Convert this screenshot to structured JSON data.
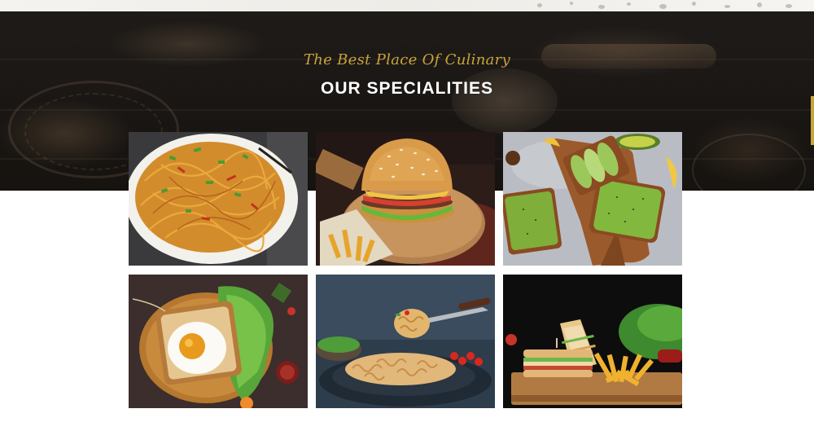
{
  "section": {
    "subtitle": "The Best Place Of Culinary",
    "title": "OUR SPECIALITIES"
  },
  "colors": {
    "accent": "#c9a33c",
    "hero_bg": "#1b1815",
    "title": "#ffffff"
  },
  "gallery": {
    "items": [
      {
        "icon": "noodles-photo"
      },
      {
        "icon": "burger-photo"
      },
      {
        "icon": "avocado-toast-photo"
      },
      {
        "icon": "egg-toast-photo"
      },
      {
        "icon": "pasta-photo"
      },
      {
        "icon": "sandwich-fries-photo"
      }
    ]
  }
}
